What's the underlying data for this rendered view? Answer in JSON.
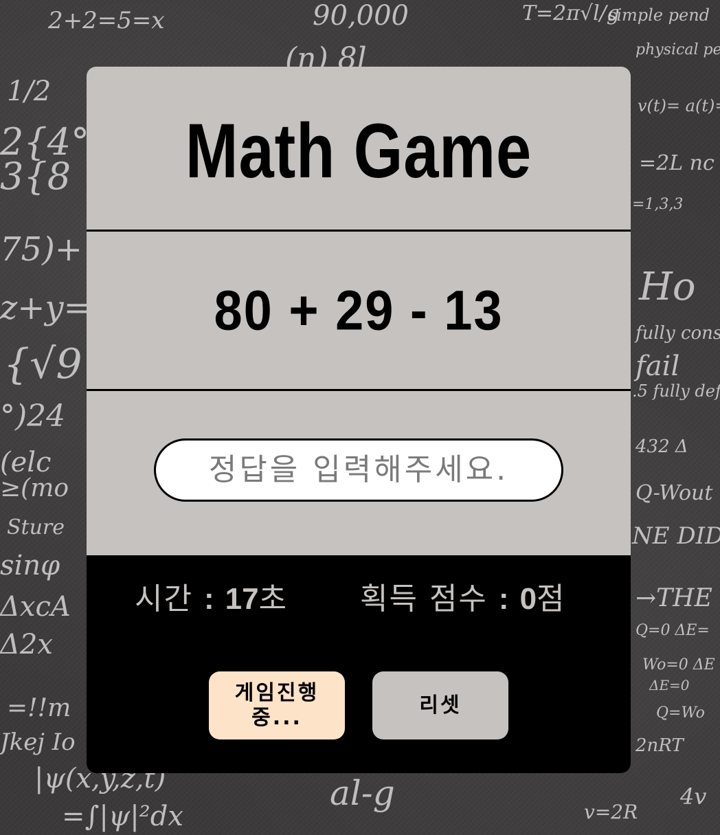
{
  "app": {
    "title": "Math Game"
  },
  "game": {
    "problem": "80 + 29 - 13",
    "answer_placeholder": "정답을 입력해주세요.",
    "answer_value": ""
  },
  "stats": {
    "time_label": "시간",
    "time_value": "17",
    "time_unit": "초",
    "score_label": "획득 점수",
    "score_value": "0",
    "score_unit": "점",
    "separator": ":"
  },
  "buttons": {
    "start_label": "게임진행중...",
    "reset_label": "리셋"
  },
  "colors": {
    "card_background": "#c6c2c0",
    "panel_background": "#000000",
    "start_button": "#fde3c8",
    "reset_button": "#c6c2c0",
    "chalkboard": "#3b3939"
  }
}
